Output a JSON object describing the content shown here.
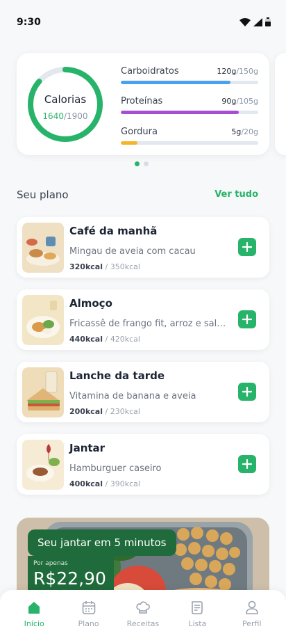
{
  "status_bar": {
    "time": "9:30"
  },
  "calories": {
    "label": "Calorias",
    "current": "1640",
    "goal": "/1900",
    "progress": 0.863,
    "color": "#27b46a"
  },
  "macros": [
    {
      "name": "Carboidratos",
      "current": "120g",
      "goal": "/150g",
      "progress": 0.8,
      "color": "#4aa3ea"
    },
    {
      "name": "Proteínas",
      "current": "90g",
      "goal": "/105g",
      "progress": 0.857,
      "color": "#a74fd3"
    },
    {
      "name": "Gordura",
      "current": "5g",
      "goal": "/20g",
      "progress": 0.12,
      "color": "#f5b52a"
    }
  ],
  "plan": {
    "title": "Seu plano",
    "see_all": "Ver tudo",
    "meals": [
      {
        "title": "Café da manhã",
        "desc": "Mingau de aveia com cacau",
        "kcal": "320kcal",
        "target": " / 350kcal",
        "icon": "breakfast-image"
      },
      {
        "title": "Almoço",
        "desc": "Fricassê de frango fit, arroz e salada",
        "kcal": "440kcal",
        "target": " / 420kcal",
        "icon": "lunch-image"
      },
      {
        "title": "Lanche da tarde",
        "desc": "Vitamina de banana e aveia",
        "kcal": "200kcal",
        "target": " / 230kcal",
        "icon": "snack-image"
      },
      {
        "title": "Jantar",
        "desc": "Hamburguer caseiro",
        "kcal": "400kcal",
        "target": " / 390kcal",
        "icon": "dinner-image"
      }
    ]
  },
  "promo": {
    "headline": "Seu jantar em 5 minutos",
    "price_label": "Por apenas",
    "price": "R$22,90"
  },
  "tabs": [
    {
      "label": "Início",
      "icon": "home-icon",
      "active": true
    },
    {
      "label": "Plano",
      "icon": "calendar-icon",
      "active": false
    },
    {
      "label": "Receitas",
      "icon": "chef-hat-icon",
      "active": false
    },
    {
      "label": "Lista",
      "icon": "list-icon",
      "active": false
    },
    {
      "label": "Perfil",
      "icon": "user-icon",
      "active": false
    }
  ],
  "colors": {
    "accent": "#27b46a",
    "promo_green": "#1f6b3b"
  }
}
